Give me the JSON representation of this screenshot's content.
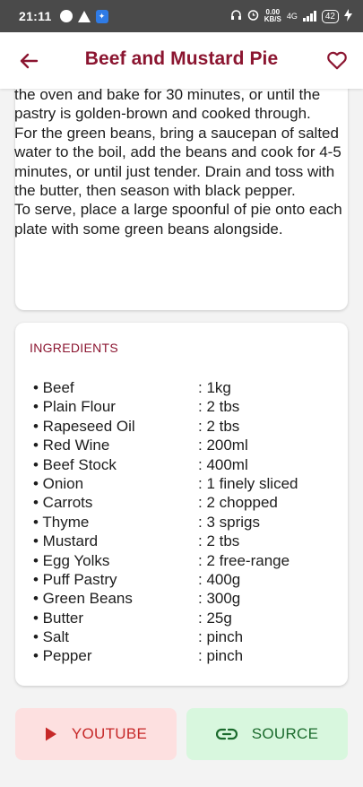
{
  "status_bar": {
    "time": "21:11",
    "speed_value": "0.00",
    "speed_unit": "KB/S",
    "network": "4G",
    "battery": "42"
  },
  "app_bar": {
    "title": "Beef and Mustard Pie",
    "back_icon": "arrow-left-icon",
    "favorite_icon": "heart-outline-icon"
  },
  "instructions": {
    "lines": [
      "the oven and bake for 30 minutes, or until the pastry is golden-brown and cooked through.",
      "For the green beans, bring a saucepan of salted water to the boil, add the beans and cook for 4-5 minutes, or until just tender. Drain and toss with the butter, then season with black pepper.",
      "To serve, place a large spoonful of pie onto each plate with some green beans alongside."
    ]
  },
  "ingredients": {
    "heading": "INGREDIENTS",
    "items": [
      {
        "name": "• Beef",
        "qty": ": 1kg"
      },
      {
        "name": "• Plain Flour",
        "qty": ": 2 tbs"
      },
      {
        "name": "• Rapeseed Oil",
        "qty": ": 2 tbs"
      },
      {
        "name": "• Red Wine",
        "qty": ": 200ml"
      },
      {
        "name": "• Beef Stock",
        "qty": ": 400ml"
      },
      {
        "name": "• Onion",
        "qty": ": 1 finely sliced"
      },
      {
        "name": "• Carrots",
        "qty": ": 2 chopped"
      },
      {
        "name": "• Thyme",
        "qty": ": 3 sprigs"
      },
      {
        "name": "• Mustard",
        "qty": ": 2 tbs"
      },
      {
        "name": "• Egg Yolks",
        "qty": ": 2 free-range"
      },
      {
        "name": "• Puff Pastry",
        "qty": ": 400g"
      },
      {
        "name": "• Green Beans",
        "qty": ": 300g"
      },
      {
        "name": "• Butter",
        "qty": ": 25g"
      },
      {
        "name": "• Salt",
        "qty": ": pinch"
      },
      {
        "name": "• Pepper",
        "qty": ": pinch"
      }
    ]
  },
  "actions": {
    "youtube_label": "YOUTUBE",
    "youtube_icon": "play-icon",
    "source_label": "SOURCE",
    "source_icon": "link-icon"
  },
  "colors": {
    "accent": "#8b1530",
    "youtube_bg": "#fde0e0",
    "youtube_fg": "#c62828",
    "source_bg": "#d8f7de",
    "source_fg": "#1b6b2d"
  }
}
